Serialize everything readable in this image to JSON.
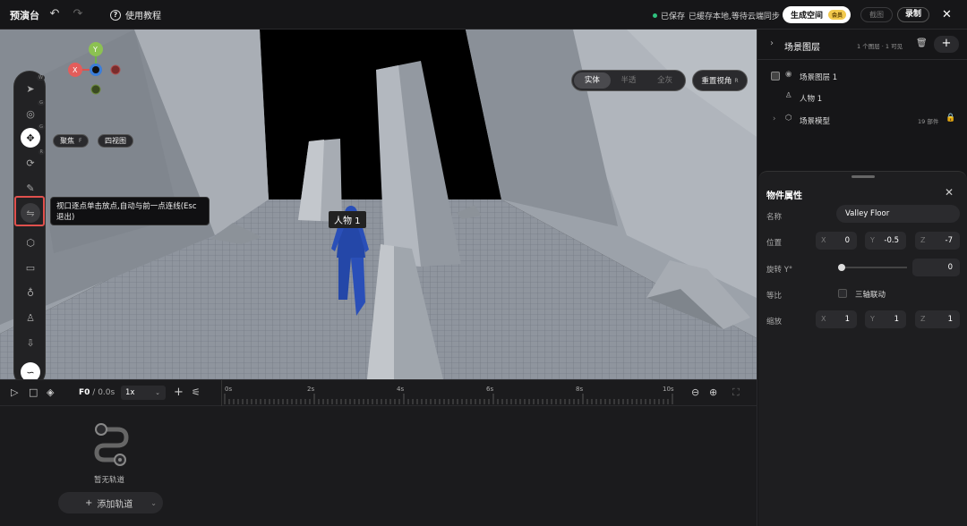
{
  "topbar": {
    "title": "预演台",
    "help_label": "使用教程",
    "saved_label": "已保存",
    "cache_label": "已缓存本地,等待云端同步",
    "generate_label": "生成空间",
    "vip_label": "会员",
    "screenshot_label": "截图",
    "record_label": "录制"
  },
  "viewport": {
    "axes": {
      "y": "Y",
      "x": "X"
    },
    "focus_label": "聚焦",
    "focus_key": "F",
    "fourview_label": "四视图",
    "modes": [
      "实体",
      "半透",
      "全灰"
    ],
    "active_mode": "实体",
    "reset_view_label": "重置视角",
    "reset_view_key": "R",
    "character_label": "人物 1",
    "tooltip": "视口逐点单击放点,自动与前一点连线(Esc退出)",
    "toolbar_shortcuts": {
      "select": "W",
      "orbit": "G",
      "move": "G",
      "rotate": "R"
    }
  },
  "timeline": {
    "frame": "F0",
    "time": "/ 0.0s",
    "speed": "1x",
    "ticks": [
      "0s",
      "2s",
      "4s",
      "6s",
      "8s",
      "10s"
    ],
    "empty_label": "暂无轨道",
    "add_track_label": "添加轨道"
  },
  "layers": {
    "title": "场景图层",
    "count": "1 个图层 · 1 可见",
    "items": [
      {
        "label": "场景图层 1"
      },
      {
        "label": "人物 1"
      },
      {
        "label": "场景模型",
        "meta": "19 部件"
      }
    ]
  },
  "properties": {
    "title": "物件属性",
    "name_label": "名称",
    "name_value": "Valley Floor",
    "position_label": "位置",
    "position": {
      "x": "0",
      "y": "-0.5",
      "z": "-7"
    },
    "rotation_label": "旋转 Y°",
    "rotation_value": "0",
    "uniform_label": "等比",
    "link_label": "三轴联动",
    "scale_label": "缩放",
    "scale": {
      "x": "1",
      "y": "1",
      "z": "1"
    }
  },
  "colors": {
    "background": "#1b1b1d",
    "accent_green": "#2ec27e",
    "vip_gold": "#f2c94c",
    "highlight_red": "#e0504d",
    "character_blue": "#2a4fb8"
  }
}
